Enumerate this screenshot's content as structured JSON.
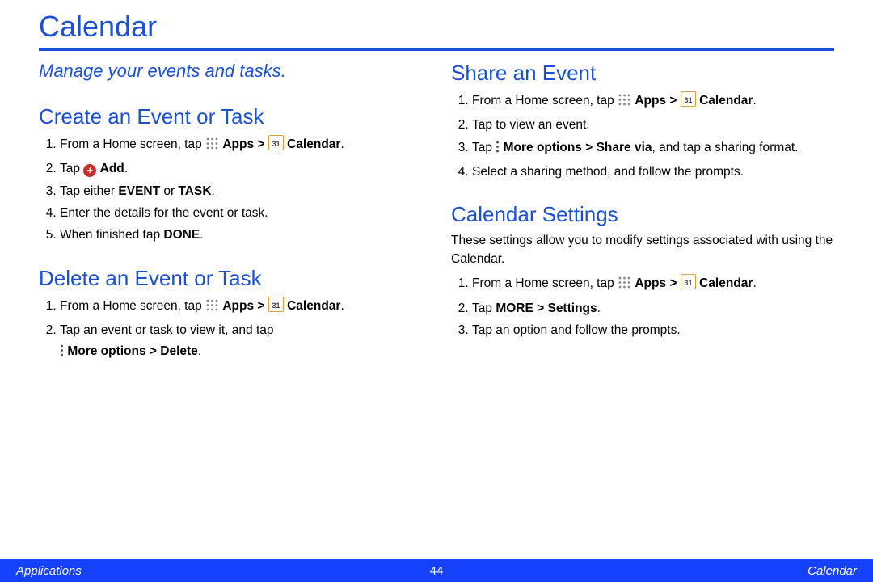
{
  "title": "Calendar",
  "subtitle": "Manage your events and tasks.",
  "tokens": {
    "apps": "Apps",
    "calendar": "Calendar",
    "gt": ">"
  },
  "create": {
    "heading": "Create an Event or Task",
    "s1_a": "From a Home screen, tap",
    "s1_apps": "Apps",
    "s1_gt": ">",
    "s1_cal": "Calendar",
    "s1_end": ".",
    "s2_a": "Tap",
    "s2_add": "Add",
    "s2_end": ".",
    "s3_a": "Tap either ",
    "s3_event": "EVENT",
    "s3_or": " or ",
    "s3_task": "TASK",
    "s3_end": ".",
    "s4": "Enter the details for the event or task.",
    "s5_a": "When finished tap ",
    "s5_done": "DONE",
    "s5_end": "."
  },
  "delete": {
    "heading": "Delete an Event or Task",
    "s1_a": "From a Home screen, tap",
    "s1_apps": "Apps",
    "s1_gt": ">",
    "s1_cal": "Calendar",
    "s1_end": ".",
    "s2_a": "Tap an event or task to view it, and tap",
    "s2_more": "More options > Delete",
    "s2_end": "."
  },
  "share": {
    "heading": "Share an Event",
    "s1_a": "From a Home screen, tap",
    "s1_apps": "Apps",
    "s1_gt": ">",
    "s1_cal": "Calendar",
    "s1_end": ".",
    "s2": "Tap to view an event.",
    "s3_a": "Tap",
    "s3_more": "More options > Share via",
    "s3_b": ", and tap a sharing format.",
    "s4": "Select a sharing method, and follow the prompts."
  },
  "settings": {
    "heading": "Calendar Settings",
    "lead": "These settings allow you to modify settings associated with using the Calendar.",
    "s1_a": "From a Home screen, tap",
    "s1_apps": "Apps",
    "s1_gt": ">",
    "s1_cal": "Calendar",
    "s1_end": ".",
    "s2_a": "Tap ",
    "s2_more": "MORE > Settings",
    "s2_end": ".",
    "s3": "Tap an option and follow the prompts."
  },
  "footer": {
    "left": "Applications",
    "center": "44",
    "right": "Calendar"
  }
}
